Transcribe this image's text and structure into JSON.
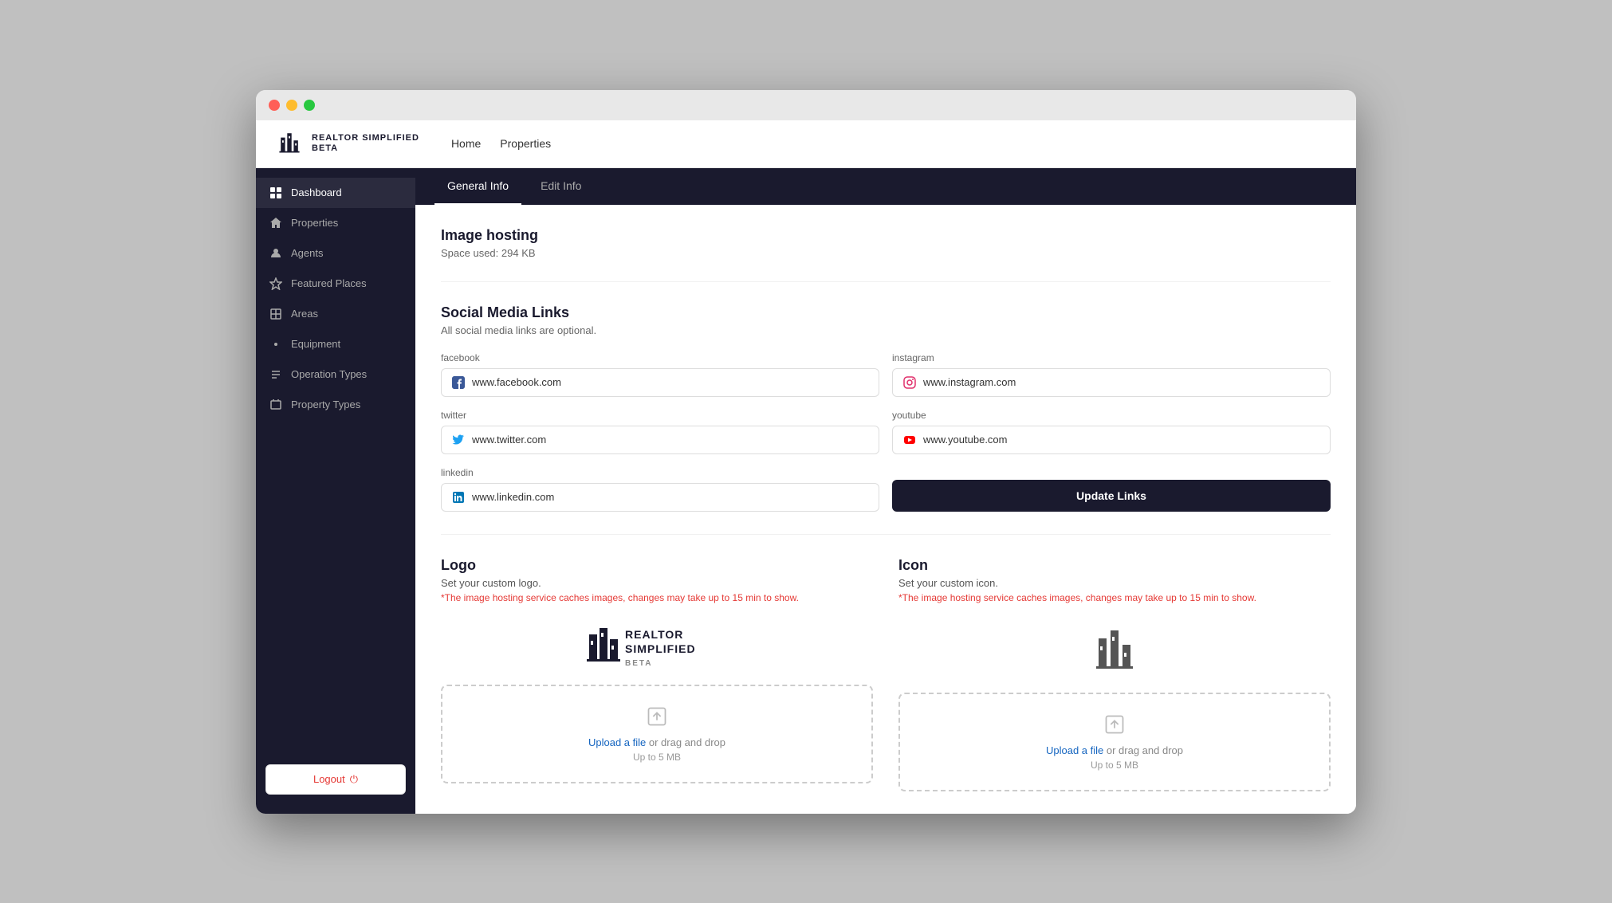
{
  "window": {
    "titlebar": {
      "btn_close": "",
      "btn_min": "",
      "btn_max": ""
    }
  },
  "topnav": {
    "logo_text": "REALTOR\nSIMPLIFIED",
    "logo_beta": "BETA",
    "links": [
      {
        "label": "Home",
        "href": "#"
      },
      {
        "label": "Properties",
        "href": "#"
      }
    ]
  },
  "sidebar": {
    "items": [
      {
        "id": "dashboard",
        "label": "Dashboard",
        "active": true
      },
      {
        "id": "properties",
        "label": "Properties",
        "active": false
      },
      {
        "id": "agents",
        "label": "Agents",
        "active": false
      },
      {
        "id": "featured-places",
        "label": "Featured Places",
        "active": false
      },
      {
        "id": "areas",
        "label": "Areas",
        "active": false
      },
      {
        "id": "equipment",
        "label": "Equipment",
        "active": false
      },
      {
        "id": "operation-types",
        "label": "Operation Types",
        "active": false
      },
      {
        "id": "property-types",
        "label": "Property Types",
        "active": false
      }
    ],
    "logout_label": "Logout"
  },
  "tabs": [
    {
      "id": "general-info",
      "label": "General Info",
      "active": true
    },
    {
      "id": "edit-info",
      "label": "Edit Info",
      "active": false
    }
  ],
  "image_hosting": {
    "title": "Image hosting",
    "space_used": "Space used: 294 KB"
  },
  "social_media": {
    "title": "Social Media Links",
    "subtitle": "All social media links are optional.",
    "fields": [
      {
        "id": "facebook",
        "label": "facebook",
        "value": "www.facebook.com",
        "icon": "facebook"
      },
      {
        "id": "instagram",
        "label": "instagram",
        "value": "www.instagram.com",
        "icon": "instagram"
      },
      {
        "id": "twitter",
        "label": "twitter",
        "value": "www.twitter.com",
        "icon": "twitter"
      },
      {
        "id": "youtube",
        "label": "youtube",
        "value": "www.youtube.com",
        "icon": "youtube"
      },
      {
        "id": "linkedin",
        "label": "linkedin",
        "value": "www.linkedin.com",
        "icon": "linkedin"
      }
    ],
    "update_btn": "Update Links"
  },
  "logo_section": {
    "title": "Logo",
    "subtitle": "Set your custom logo.",
    "warning": "*The image hosting service caches images, changes may take up to 15 min to show.",
    "upload_text": "Upload a file",
    "upload_suffix": " or drag and drop",
    "upload_size": "Up to 5 MB"
  },
  "icon_section": {
    "title": "Icon",
    "subtitle": "Set your custom icon.",
    "warning": "*The image hosting service caches images, changes may take up to 15 min to show.",
    "upload_text": "Upload a file",
    "upload_suffix": " or drag and drop",
    "upload_size": "Up to 5 MB"
  }
}
